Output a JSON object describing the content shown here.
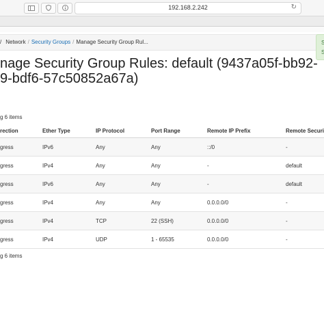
{
  "browser": {
    "url": "192.168.2.242",
    "back_icon": "sidebar-icon",
    "reload_icon": "reload-icon"
  },
  "breadcrumb": {
    "items": [
      "/",
      "Network",
      "Security Groups",
      "Manage Security Group Rul..."
    ]
  },
  "toast": {
    "text": "S",
    "text2": "Su"
  },
  "page": {
    "title_line1": "nage Security Group Rules: default (9437a05f-bb92-",
    "title_line2": "9-bdf6-57c50852a67a)",
    "summary_top": "g 6 items",
    "summary_bottom": "g 6 items"
  },
  "table": {
    "headers": [
      "rection",
      "Ether Type",
      "IP Protocol",
      "Port Range",
      "Remote IP Prefix",
      "Remote Security"
    ],
    "rows": [
      [
        "gress",
        "IPv6",
        "Any",
        "Any",
        "::/0",
        "-"
      ],
      [
        "gress",
        "IPv4",
        "Any",
        "Any",
        "-",
        "default"
      ],
      [
        "gress",
        "IPv6",
        "Any",
        "Any",
        "-",
        "default"
      ],
      [
        "gress",
        "IPv4",
        "Any",
        "Any",
        "0.0.0.0/0",
        "-"
      ],
      [
        "gress",
        "IPv4",
        "TCP",
        "22 (SSH)",
        "0.0.0.0/0",
        "-"
      ],
      [
        "gress",
        "IPv4",
        "UDP",
        "1 - 65535",
        "0.0.0.0/0",
        "-"
      ]
    ]
  },
  "colors": {
    "link": "#1a6fb5",
    "success_bg": "#dff0d8",
    "success_text": "#3c763d"
  }
}
